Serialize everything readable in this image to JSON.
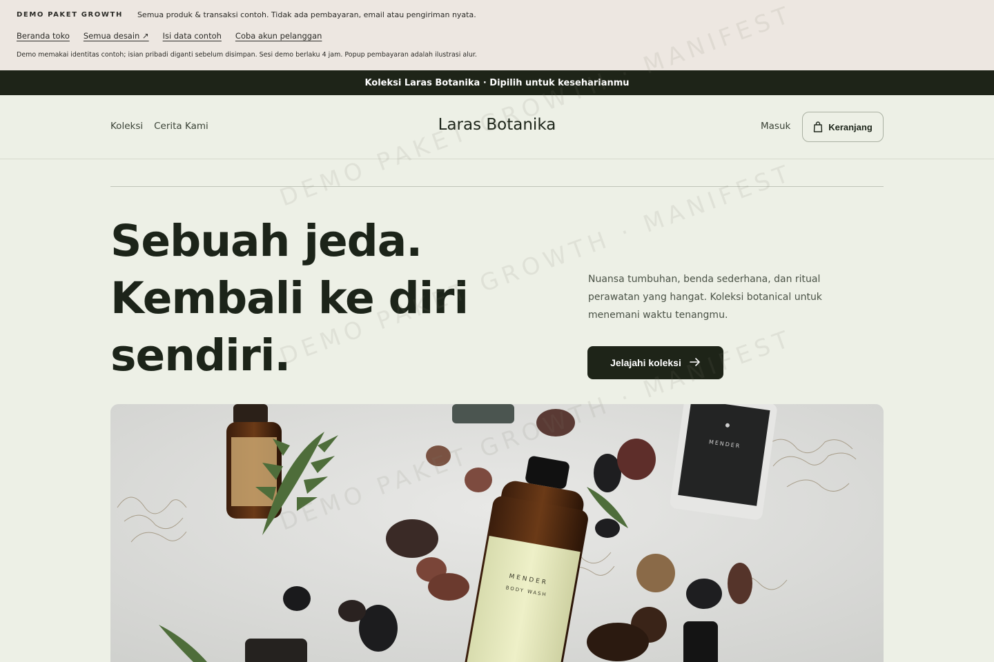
{
  "demo_bar": {
    "tag": "DEMO PAKET GROWTH",
    "note": "Semua produk & transaksi contoh. Tidak ada pembayaran, email atau pengiriman nyata.",
    "links": [
      "Beranda toko",
      "Semua desain ↗",
      "Isi data contoh",
      "Coba akun pelanggan"
    ],
    "fine_print": "Demo memakai identitas contoh; isian pribadi diganti sebelum disimpan. Sesi demo berlaku 4 jam. Popup pembayaran adalah ilustrasi alur."
  },
  "announcement": "Koleksi Laras Botanika · Dipilih untuk keseharianmu",
  "header": {
    "nav": [
      "Koleksi",
      "Cerita Kami"
    ],
    "brand": "Laras Botanika",
    "login": "Masuk",
    "cart": "Keranjang"
  },
  "hero": {
    "title_lines": [
      "Sebuah jeda.",
      "Kembali ke diri",
      "sendiri."
    ],
    "description": "Nuansa tumbuhan, benda sederhana, dan ritual perawatan yang hangat. Koleksi botanical untuk menemani waktu tenangmu.",
    "cta": "Jelajahi koleksi"
  },
  "watermark": "DEMO PAKET GROWTH · MANIFEST",
  "icons": {
    "cart": "shopping-bag-icon",
    "cta": "arrow-right-icon"
  },
  "colors": {
    "dark": "#1e2418",
    "background": "#edf0e6",
    "demo_bar": "#ede7e1"
  }
}
